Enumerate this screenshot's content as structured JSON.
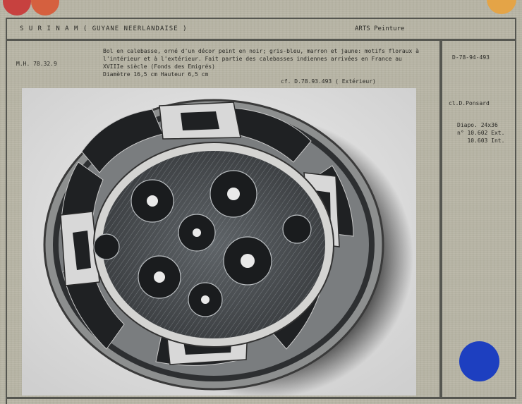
{
  "header": {
    "location": "S U R I N A M  ( GUYANE NEERLANDAISE )",
    "category": "ARTS  Peinture"
  },
  "inventory_number": "M.H. 78.32.9",
  "description": [
    "Bol en calebasse, orné d'un décor peint en noir; gris-bleu, marron et jaune: motifs floraux à",
    "l'intérieur et à l'extérieur. Fait partie des calebasses indiennes arrivées en France au",
    "XVIIIe siècle (Fonds des Emigrés)",
    "Diamètre 16,5 cm  Hauteur 6,5 cm"
  ],
  "cross_reference": "cf. D.78.93.493 ( Extérieur)",
  "sidebar": {
    "reference": "D-78-94-493",
    "credit": "cl.D.Ponsard",
    "diapo": [
      "Diapo. 24x36",
      "n° 10.602 Ext.",
      "   10.603 Int."
    ]
  },
  "colors": {
    "card": "#b9b6a6",
    "rule": "#555650",
    "dot_red": "#c7413f",
    "dot_red_light": "#d5603f",
    "dot_orange": "#e4a447",
    "dot_blue": "#1d3fc0"
  },
  "photo": {
    "subject": "calabash-bowl-photograph"
  }
}
